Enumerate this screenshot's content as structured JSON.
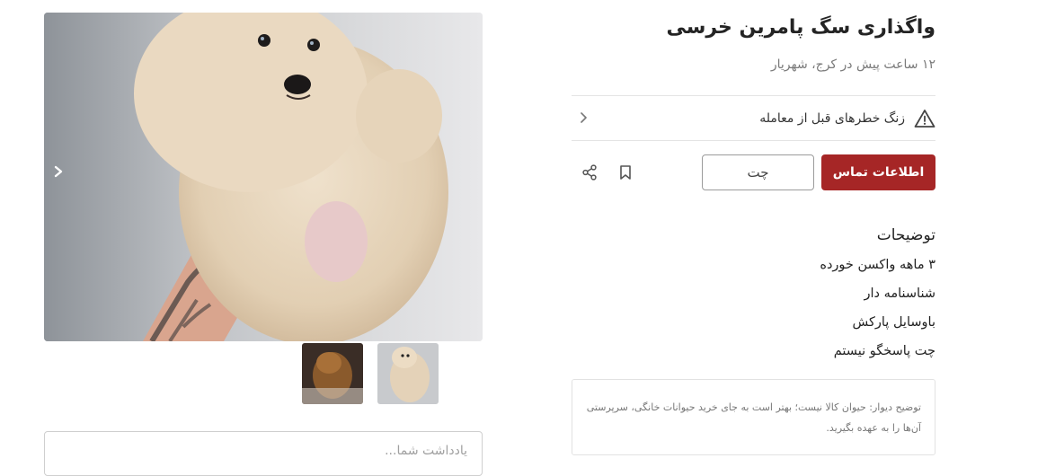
{
  "listing": {
    "title": "واگذاری سگ پامرین خرسی",
    "subtitle": "۱۲ ساعت پیش در کرج، شهریار",
    "warning": {
      "label": "زنگ خطرهای قبل از معامله",
      "icon": "warning-triangle-icon"
    },
    "actions": {
      "contact_label": "اطلاعات تماس",
      "chat_label": "چت",
      "contact_color": "#a62626"
    },
    "description": {
      "heading": "توضیحات",
      "lines": [
        "۳ ماهه واکسن خورده",
        "شناسنامه دار",
        "باوسایل پارکش",
        "چت پاسخگو نیستم"
      ]
    },
    "disclaimer": "توضیح دیوار: حیوان کالا نیست؛ بهتر است به جای خرید حیوانات خانگی، سرپرستی آن‌ها را به عهده بگیرید."
  },
  "gallery": {
    "main_image": "cream-pomeranian-puppy-held-in-tattooed-hand",
    "thumbnails": [
      "cream-pomeranian-puppy-thumbnail",
      "brown-dog-thumbnail"
    ]
  },
  "note": {
    "placeholder": "یادداشت شما..."
  }
}
